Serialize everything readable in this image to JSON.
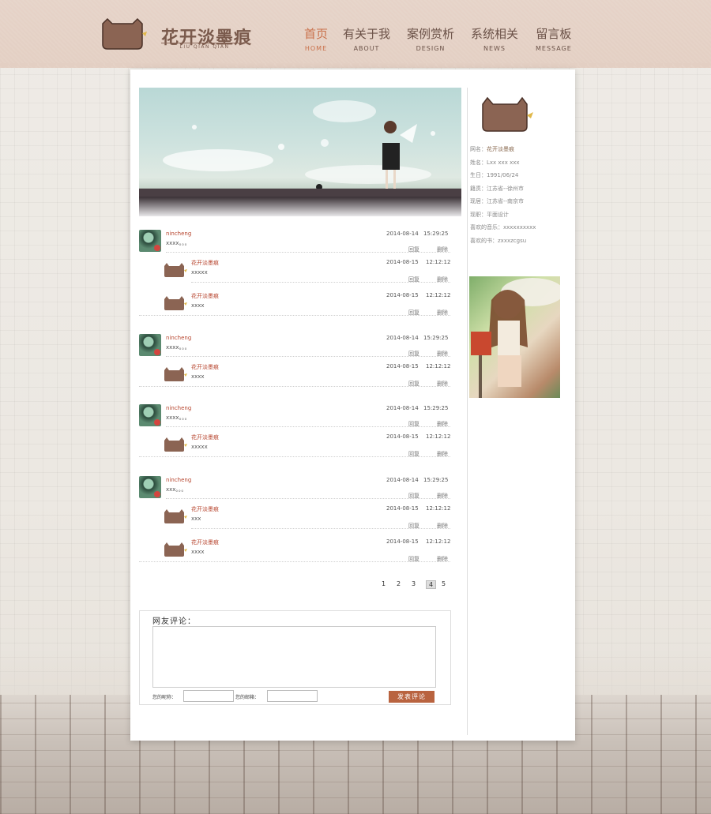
{
  "header": {
    "logo_text": "花开淡墨痕",
    "logo_sub": "LIU QIAN QIAN",
    "nav": [
      {
        "cn": "首页",
        "en": "HOME",
        "active": true
      },
      {
        "cn": "有关于我",
        "en": "ABOUT",
        "active": false
      },
      {
        "cn": "案例赏析",
        "en": "DESIGN",
        "active": false
      },
      {
        "cn": "系统相关",
        "en": "NEWS",
        "active": false
      },
      {
        "cn": "留言板",
        "en": "MESSAGE",
        "active": false
      }
    ]
  },
  "comments": [
    {
      "name": "nincheng",
      "text": "xxxx。。。",
      "date": "2014-08-14",
      "time": "15:29:25",
      "reply": "回复",
      "delete": "删除",
      "replies": [
        {
          "name": "花开淡墨痕",
          "text": "xxxxx",
          "date": "2014-08-15",
          "time": "12:12:12",
          "reply": "回复",
          "delete": "删除"
        },
        {
          "name": "花开淡墨痕",
          "text": "xxxx",
          "date": "2014-08-15",
          "time": "12:12:12",
          "reply": "回复",
          "delete": "删除"
        }
      ]
    },
    {
      "name": "nincheng",
      "text": "xxxx。。。",
      "date": "2014-08-14",
      "time": "15:29:25",
      "reply": "回复",
      "delete": "删除",
      "replies": [
        {
          "name": "花开淡墨痕",
          "text": "xxxx",
          "date": "2014-08-15",
          "time": "12:12:12",
          "reply": "回复",
          "delete": "删除"
        }
      ]
    },
    {
      "name": "nincheng",
      "text": "xxxx。。。",
      "date": "2014-08-14",
      "time": "15:29:25",
      "reply": "回复",
      "delete": "删除",
      "replies": [
        {
          "name": "花开淡墨痕",
          "text": "xxxxx",
          "date": "2014-08-15",
          "time": "12:12:12",
          "reply": "回复",
          "delete": "删除"
        }
      ]
    },
    {
      "name": "nincheng",
      "text": "xxx。。。",
      "date": "2014-08-14",
      "time": "15:29:25",
      "reply": "回复",
      "delete": "删除",
      "replies": [
        {
          "name": "花开淡墨痕",
          "text": "xxx",
          "date": "2014-08-15",
          "time": "12:12:12",
          "reply": "回复",
          "delete": "删除"
        },
        {
          "name": "花开淡墨痕",
          "text": "xxxx",
          "date": "2014-08-15",
          "time": "12:12:12",
          "reply": "回复",
          "delete": "删除"
        }
      ]
    }
  ],
  "pagination": {
    "pages": [
      "1",
      "2",
      "3",
      "4",
      "5"
    ],
    "current": "4"
  },
  "form": {
    "title": "网友评论：",
    "nickname_label": "您的昵称：",
    "email_label": "您的邮箱：",
    "submit": "发表评论"
  },
  "profile": {
    "rows": [
      {
        "label": "网名：",
        "value": "花开淡墨痕",
        "highlight": true
      },
      {
        "label": "姓名：",
        "value": "Lxx xxx xxx",
        "highlight": false
      },
      {
        "label": "生日：",
        "value": "1991/06/24",
        "highlight": false
      },
      {
        "label": "籍贯：",
        "value": "江苏省--徐州市",
        "highlight": false
      },
      {
        "label": "现居：",
        "value": "江苏省--南京市",
        "highlight": false
      },
      {
        "label": "现职：",
        "value": "平面设计",
        "highlight": false
      },
      {
        "label": "喜欢的音乐：",
        "value": "xxxxxxxxxx",
        "highlight": false
      },
      {
        "label": "喜欢的书：",
        "value": "zxxxzcgsu",
        "highlight": false
      }
    ]
  },
  "colors": {
    "accent": "#c9704a",
    "name": "#b7452e",
    "brand": "#8b6a5c",
    "button": "#b9633f"
  }
}
